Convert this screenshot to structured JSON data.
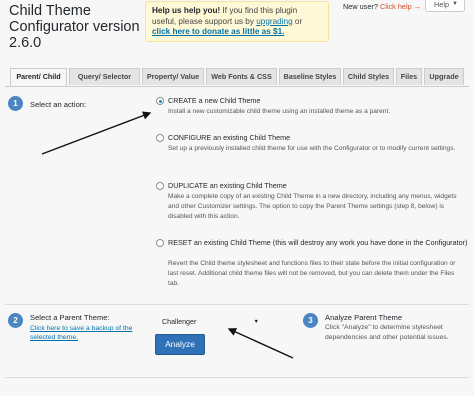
{
  "header": {
    "title": "Child Theme Configurator version 2.6.0",
    "notice": {
      "heading": "Help us help you!",
      "text1": " If you find this plugin useful, please support us by ",
      "upgrade_link": "upgrading",
      "text2": " or ",
      "donate_link": "click here to donate as little as $1."
    },
    "new_user_text": "New user?",
    "new_user_link": "Click help →",
    "help_button": "Help"
  },
  "tabs": [
    {
      "label": "Parent/ Child",
      "active": true
    },
    {
      "label": "Query/ Selector",
      "active": false
    },
    {
      "label": "Property/ Value",
      "active": false
    },
    {
      "label": "Web Fonts & CSS",
      "active": false
    },
    {
      "label": "Baseline Styles",
      "active": false
    },
    {
      "label": "Child Styles",
      "active": false
    },
    {
      "label": "Files",
      "active": false
    },
    {
      "label": "Upgrade",
      "active": false
    }
  ],
  "section1": {
    "step": "1",
    "label": "Select an action:",
    "options": [
      {
        "title": "CREATE a new Child Theme",
        "desc": "Install a new customizable child theme using an installed theme as a parent.",
        "checked": true
      },
      {
        "title": "CONFIGURE an existing Child Theme",
        "desc": "Set up a previously installed child theme for use with the Configurator or to modify current settings.",
        "checked": false
      },
      {
        "title": "DUPLICATE an existing Child Theme",
        "desc": "Make a complete copy of an existing Child Theme in a new directory, including any menus, widgets and other Customizer settings. The option to copy the Parent Theme settings (step 8, below) is disabled with this action.",
        "checked": false
      },
      {
        "title": "RESET an existing Child Theme (this will destroy any work you have done in the Configurator)",
        "desc": "Revert the Child theme stylesheet and functions files to their state before the initial configuration or last reset. Additional child theme files will not be removed, but you can delete them under the Files tab.",
        "checked": false
      }
    ]
  },
  "section2": {
    "step": "2",
    "label": "Select a Parent Theme:",
    "backup_link": "Click here to save a backup of the selected theme.",
    "selected_theme": "Challenger",
    "analyze_button": "Analyze"
  },
  "section3": {
    "step": "3",
    "label": "Analyze Parent Theme",
    "desc": "Click \"Analyze\" to determine stylesheet dependencies and other potential issues."
  },
  "colors": {
    "accent": "#4b86c3",
    "button": "#2f72b8",
    "link": "#0073aa",
    "help_link": "#d54e21",
    "notice_bg": "#fff8d6"
  }
}
